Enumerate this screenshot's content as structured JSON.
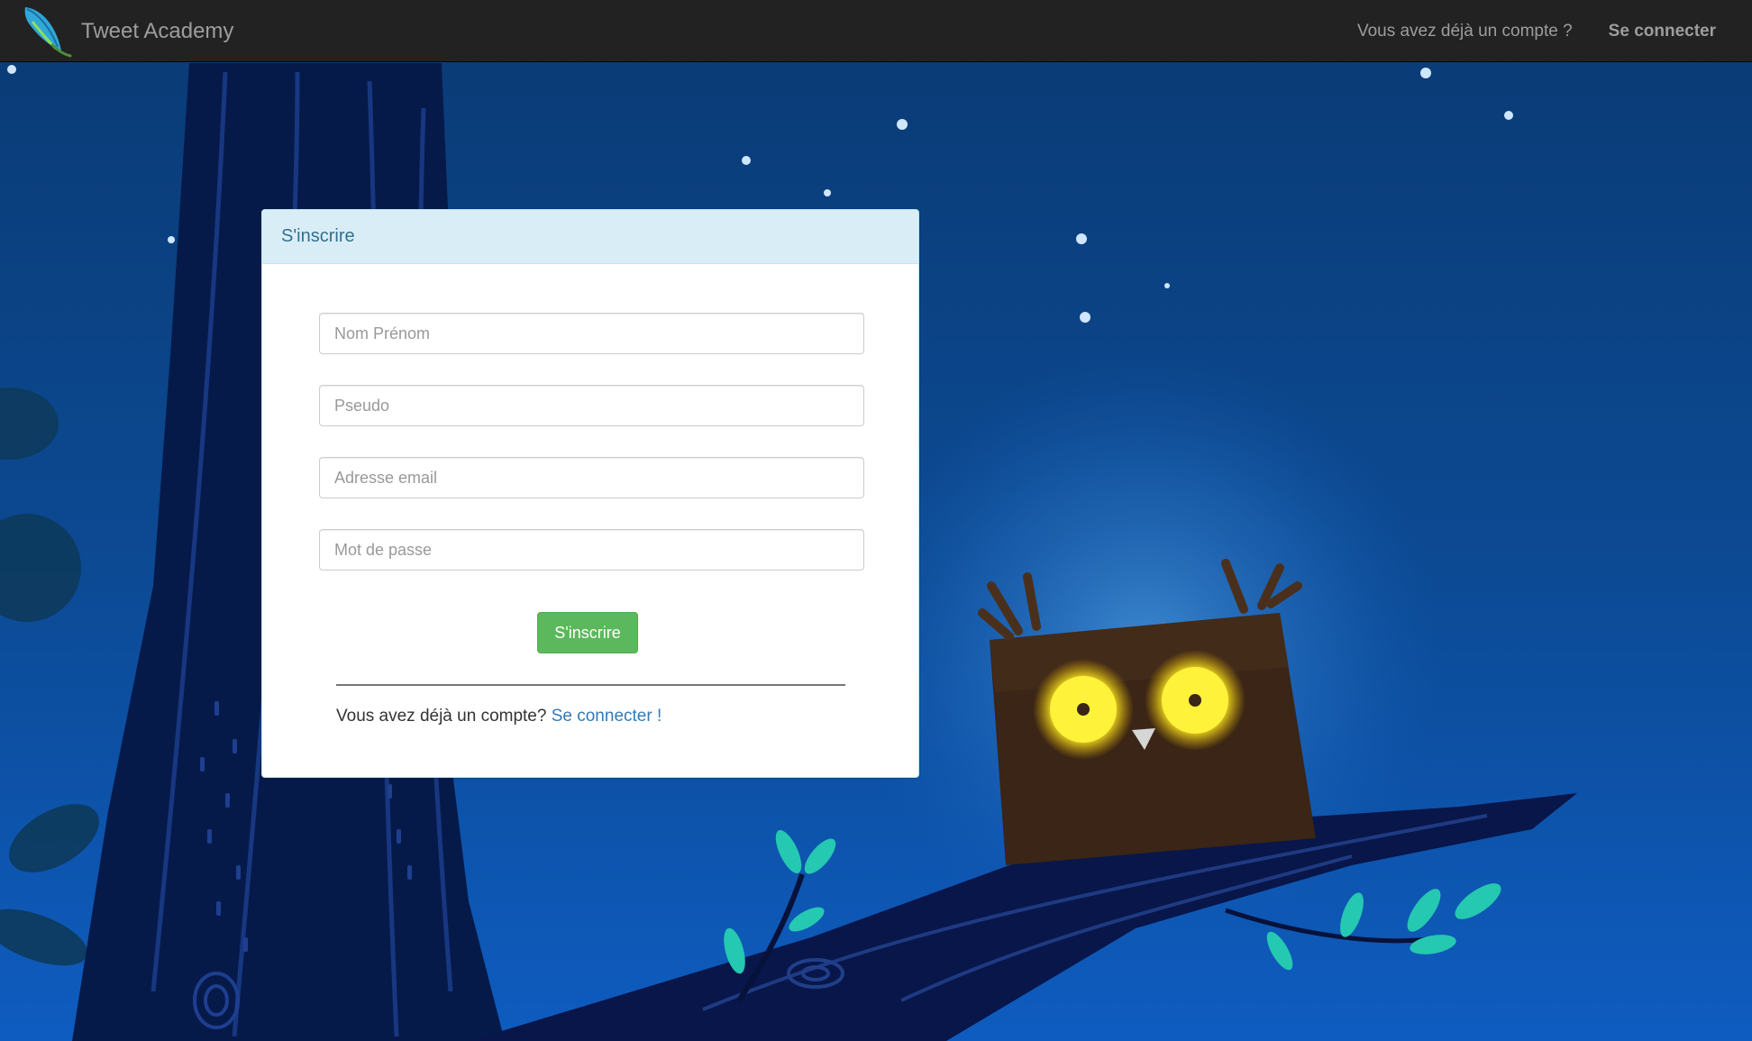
{
  "navbar": {
    "brand_name": "Tweet Academy",
    "logo_icon": "feather-icon",
    "question_text": "Vous avez déjà un compte ?",
    "login_label": "Se connecter",
    "background_color": "#222222"
  },
  "signup_panel": {
    "title": "S'inscrire",
    "fields": {
      "full_name": {
        "placeholder": "Nom Prénom",
        "value": ""
      },
      "username": {
        "placeholder": "Pseudo",
        "value": ""
      },
      "email": {
        "placeholder": "Adresse email",
        "value": ""
      },
      "password": {
        "placeholder": "Mot de passe",
        "value": ""
      }
    },
    "submit_label": "S'inscrire",
    "footer_text": "Vous avez déjà un compte?",
    "footer_link": "Se connecter !"
  },
  "colors": {
    "accent_green": "#5cb85c",
    "panel_heading": "#d9edf7",
    "link_blue": "#337ab7",
    "owl_eyes": "#ffec40"
  },
  "background": {
    "subject": "owl-on-branch-night-illustration"
  }
}
